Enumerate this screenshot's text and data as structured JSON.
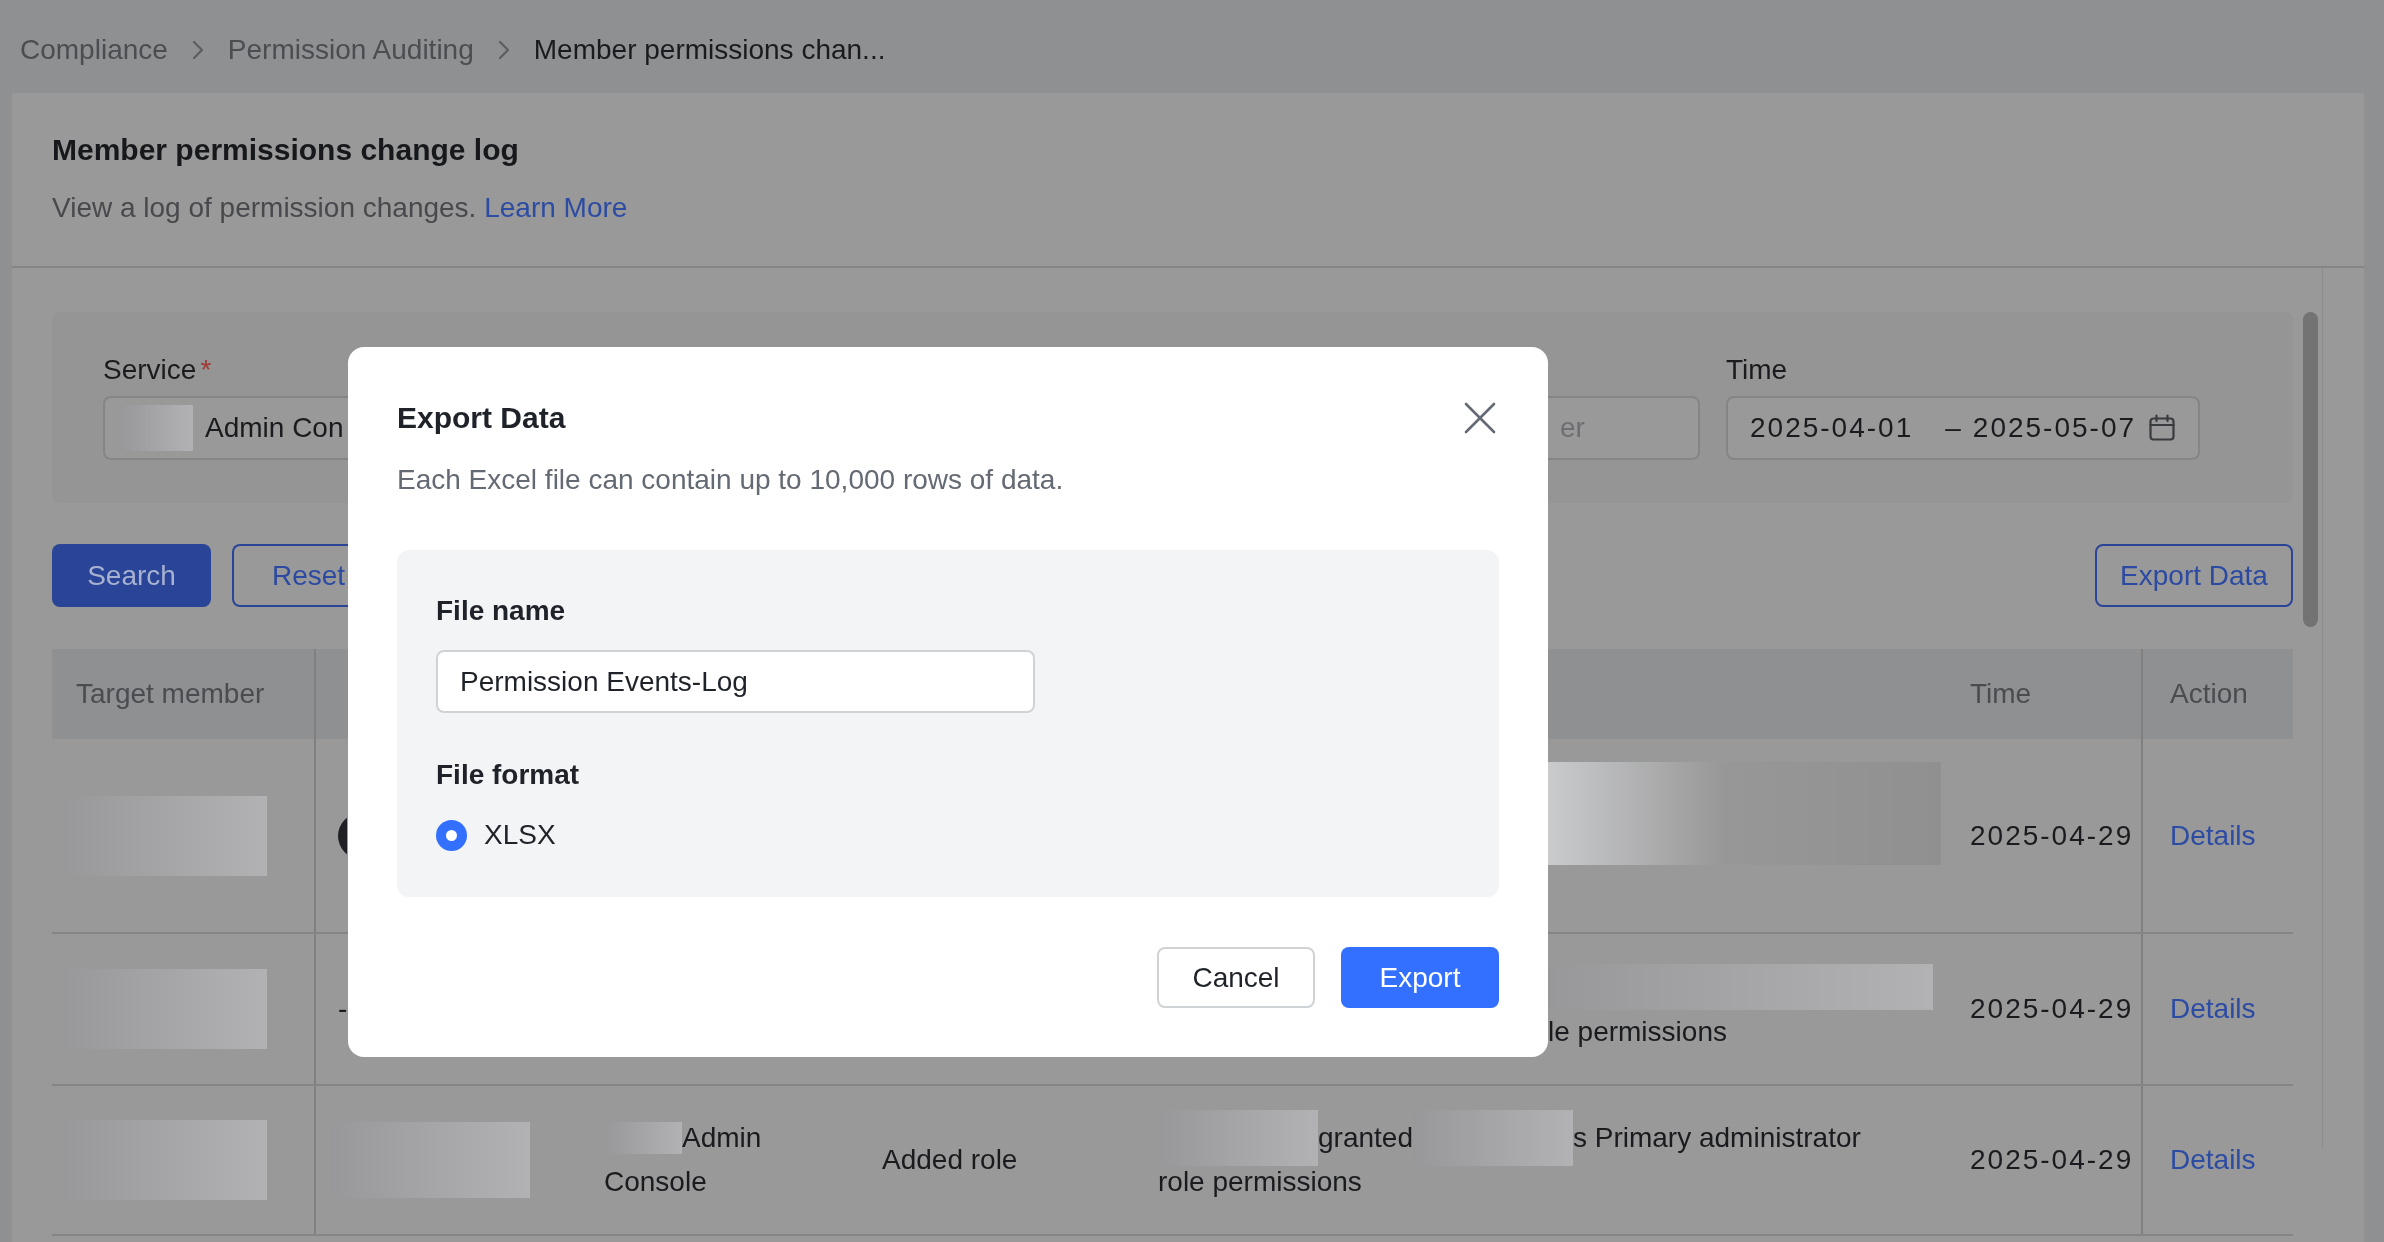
{
  "breadcrumb": [
    {
      "label": "Compliance",
      "current": false
    },
    {
      "label": "Permission Auditing",
      "current": false
    },
    {
      "label": "Member permissions chan...",
      "current": true
    }
  ],
  "header": {
    "title": "Member permissions change log",
    "description": "View a log of permission changes.",
    "link": "Learn More"
  },
  "filters": {
    "service": {
      "label": "Service",
      "required_mark": "*",
      "value": [
        {
          "kind": "redacted"
        },
        {
          "kind": "text",
          "text": "Admin Con"
        }
      ]
    },
    "member": {
      "placeholder": "er"
    },
    "time": {
      "label": "Time",
      "start": "2025-04-01",
      "separator": "–",
      "end": "2025-05-07"
    }
  },
  "buttons": [
    {
      "label": "Search",
      "kind": "primary"
    },
    {
      "label": "Reset",
      "kind": "outline"
    }
  ],
  "export_button": {
    "label": "Export Data",
    "kind": "outline"
  },
  "table": {
    "columns": {
      "target_member": "Target member",
      "time": "Time",
      "action": "Action"
    },
    "rows": [
      {
        "target_member": [
          [
            {
              "kind": "redacted"
            }
          ]
        ],
        "column_2": [
          [
            {
              "kind": "avatar"
            }
          ]
        ],
        "column_5": [
          [
            {
              "kind": "redacted"
            }
          ]
        ],
        "time": "2025-04-29",
        "action": "Details"
      },
      {
        "target_member": [
          [
            {
              "kind": "redacted"
            }
          ]
        ],
        "column_2": [
          [
            {
              "kind": "text",
              "text": "-"
            }
          ]
        ],
        "column_5": [
          [
            {
              "kind": "redacted"
            }
          ],
          [
            {
              "kind": "text",
              "text": "le permissions"
            }
          ]
        ],
        "time": "2025-04-29",
        "action": "Details"
      },
      {
        "target_member": [
          [
            {
              "kind": "redacted"
            }
          ]
        ],
        "column_2": [
          [
            {
              "kind": "redacted"
            }
          ]
        ],
        "column_3": [
          [
            {
              "kind": "redacted"
            },
            {
              "kind": "text",
              "text": "Admin"
            }
          ],
          [
            {
              "kind": "text",
              "text": "Console"
            }
          ]
        ],
        "column_4": [
          [
            {
              "kind": "text",
              "text": "Added role"
            }
          ]
        ],
        "column_5": [
          [
            {
              "kind": "redacted"
            },
            {
              "kind": "text",
              "text": "granted"
            },
            {
              "kind": "redacted"
            },
            {
              "kind": "text",
              "text": "s Primary administrator"
            }
          ],
          [
            {
              "kind": "text",
              "text": "role permissions"
            }
          ]
        ],
        "time": "2025-04-29",
        "action": "Details"
      }
    ]
  },
  "dialog": {
    "title": "Export Data",
    "description": "Each Excel file can contain up to 10,000 rows of data.",
    "file_name": {
      "label": "File name",
      "value": "Permission Events-Log"
    },
    "file_format": {
      "label": "File format",
      "options": [
        {
          "label": "XLSX",
          "selected": true
        }
      ]
    },
    "buttons": [
      {
        "label": "Cancel",
        "kind": "secondary"
      },
      {
        "label": "Export",
        "kind": "primary"
      }
    ]
  }
}
